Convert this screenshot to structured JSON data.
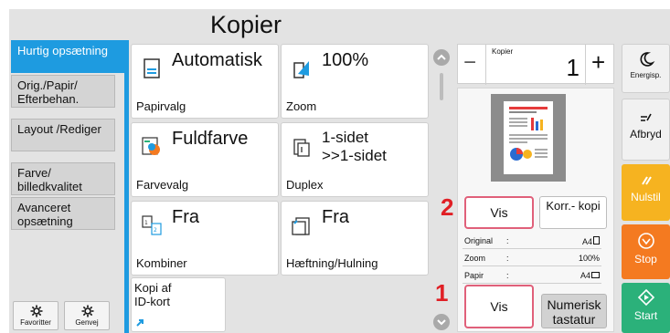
{
  "header": {
    "title": "Kopier"
  },
  "tabs": [
    {
      "label": "Hurtig opsætning"
    },
    {
      "label": "Orig./Papir/ Efterbehan."
    },
    {
      "label": "Layout /Rediger"
    },
    {
      "label": "Farve/ billedkvalitet"
    },
    {
      "label": "Avanceret opsætning"
    }
  ],
  "bottom_left": {
    "favorites": "Favoritter",
    "shortcut": "Genvej"
  },
  "tiles": [
    {
      "value": "Automatisk",
      "label": "Papirvalg",
      "icon": "paper-icon"
    },
    {
      "value": "100%",
      "label": "Zoom",
      "icon": "zoom-icon"
    },
    {
      "value": "Fuldfarve",
      "label": "Farvevalg",
      "icon": "color-icon"
    },
    {
      "value": "1-sidet >>1-sidet",
      "label": "Duplex",
      "icon": "duplex-icon"
    },
    {
      "value": "Fra",
      "label": "Kombiner",
      "icon": "combine-icon"
    },
    {
      "value": "Fra",
      "label": "Hæftning/Hulning",
      "icon": "staple-icon"
    }
  ],
  "id_card": {
    "label": "Kopi af ID-kort"
  },
  "counter": {
    "label": "Kopier",
    "value": "1",
    "minus": "−",
    "plus": "+"
  },
  "preview": {
    "vis_label": "Vis",
    "korr_label": "Korr.- kopi",
    "rows": [
      {
        "key": "Original",
        "sep": ":",
        "value": "A4"
      },
      {
        "key": "Zoom",
        "sep": ":",
        "value": "100%"
      },
      {
        "key": "Papir",
        "sep": ":",
        "value": "A4"
      }
    ]
  },
  "bottom_right": {
    "vis_label": "Vis",
    "numpad_label": "Numerisk tastatur"
  },
  "markers": {
    "one": "1",
    "two": "2"
  },
  "system": {
    "energy": "Energisp.",
    "interrupt": "Afbryd",
    "reset": "Nulstil",
    "stop": "Stop",
    "start": "Start"
  },
  "colors": {
    "accent": "#1e9be0",
    "highlight": "#e0607a",
    "reset": "#f6b320",
    "stop": "#f47a20",
    "start": "#2bb17a"
  }
}
